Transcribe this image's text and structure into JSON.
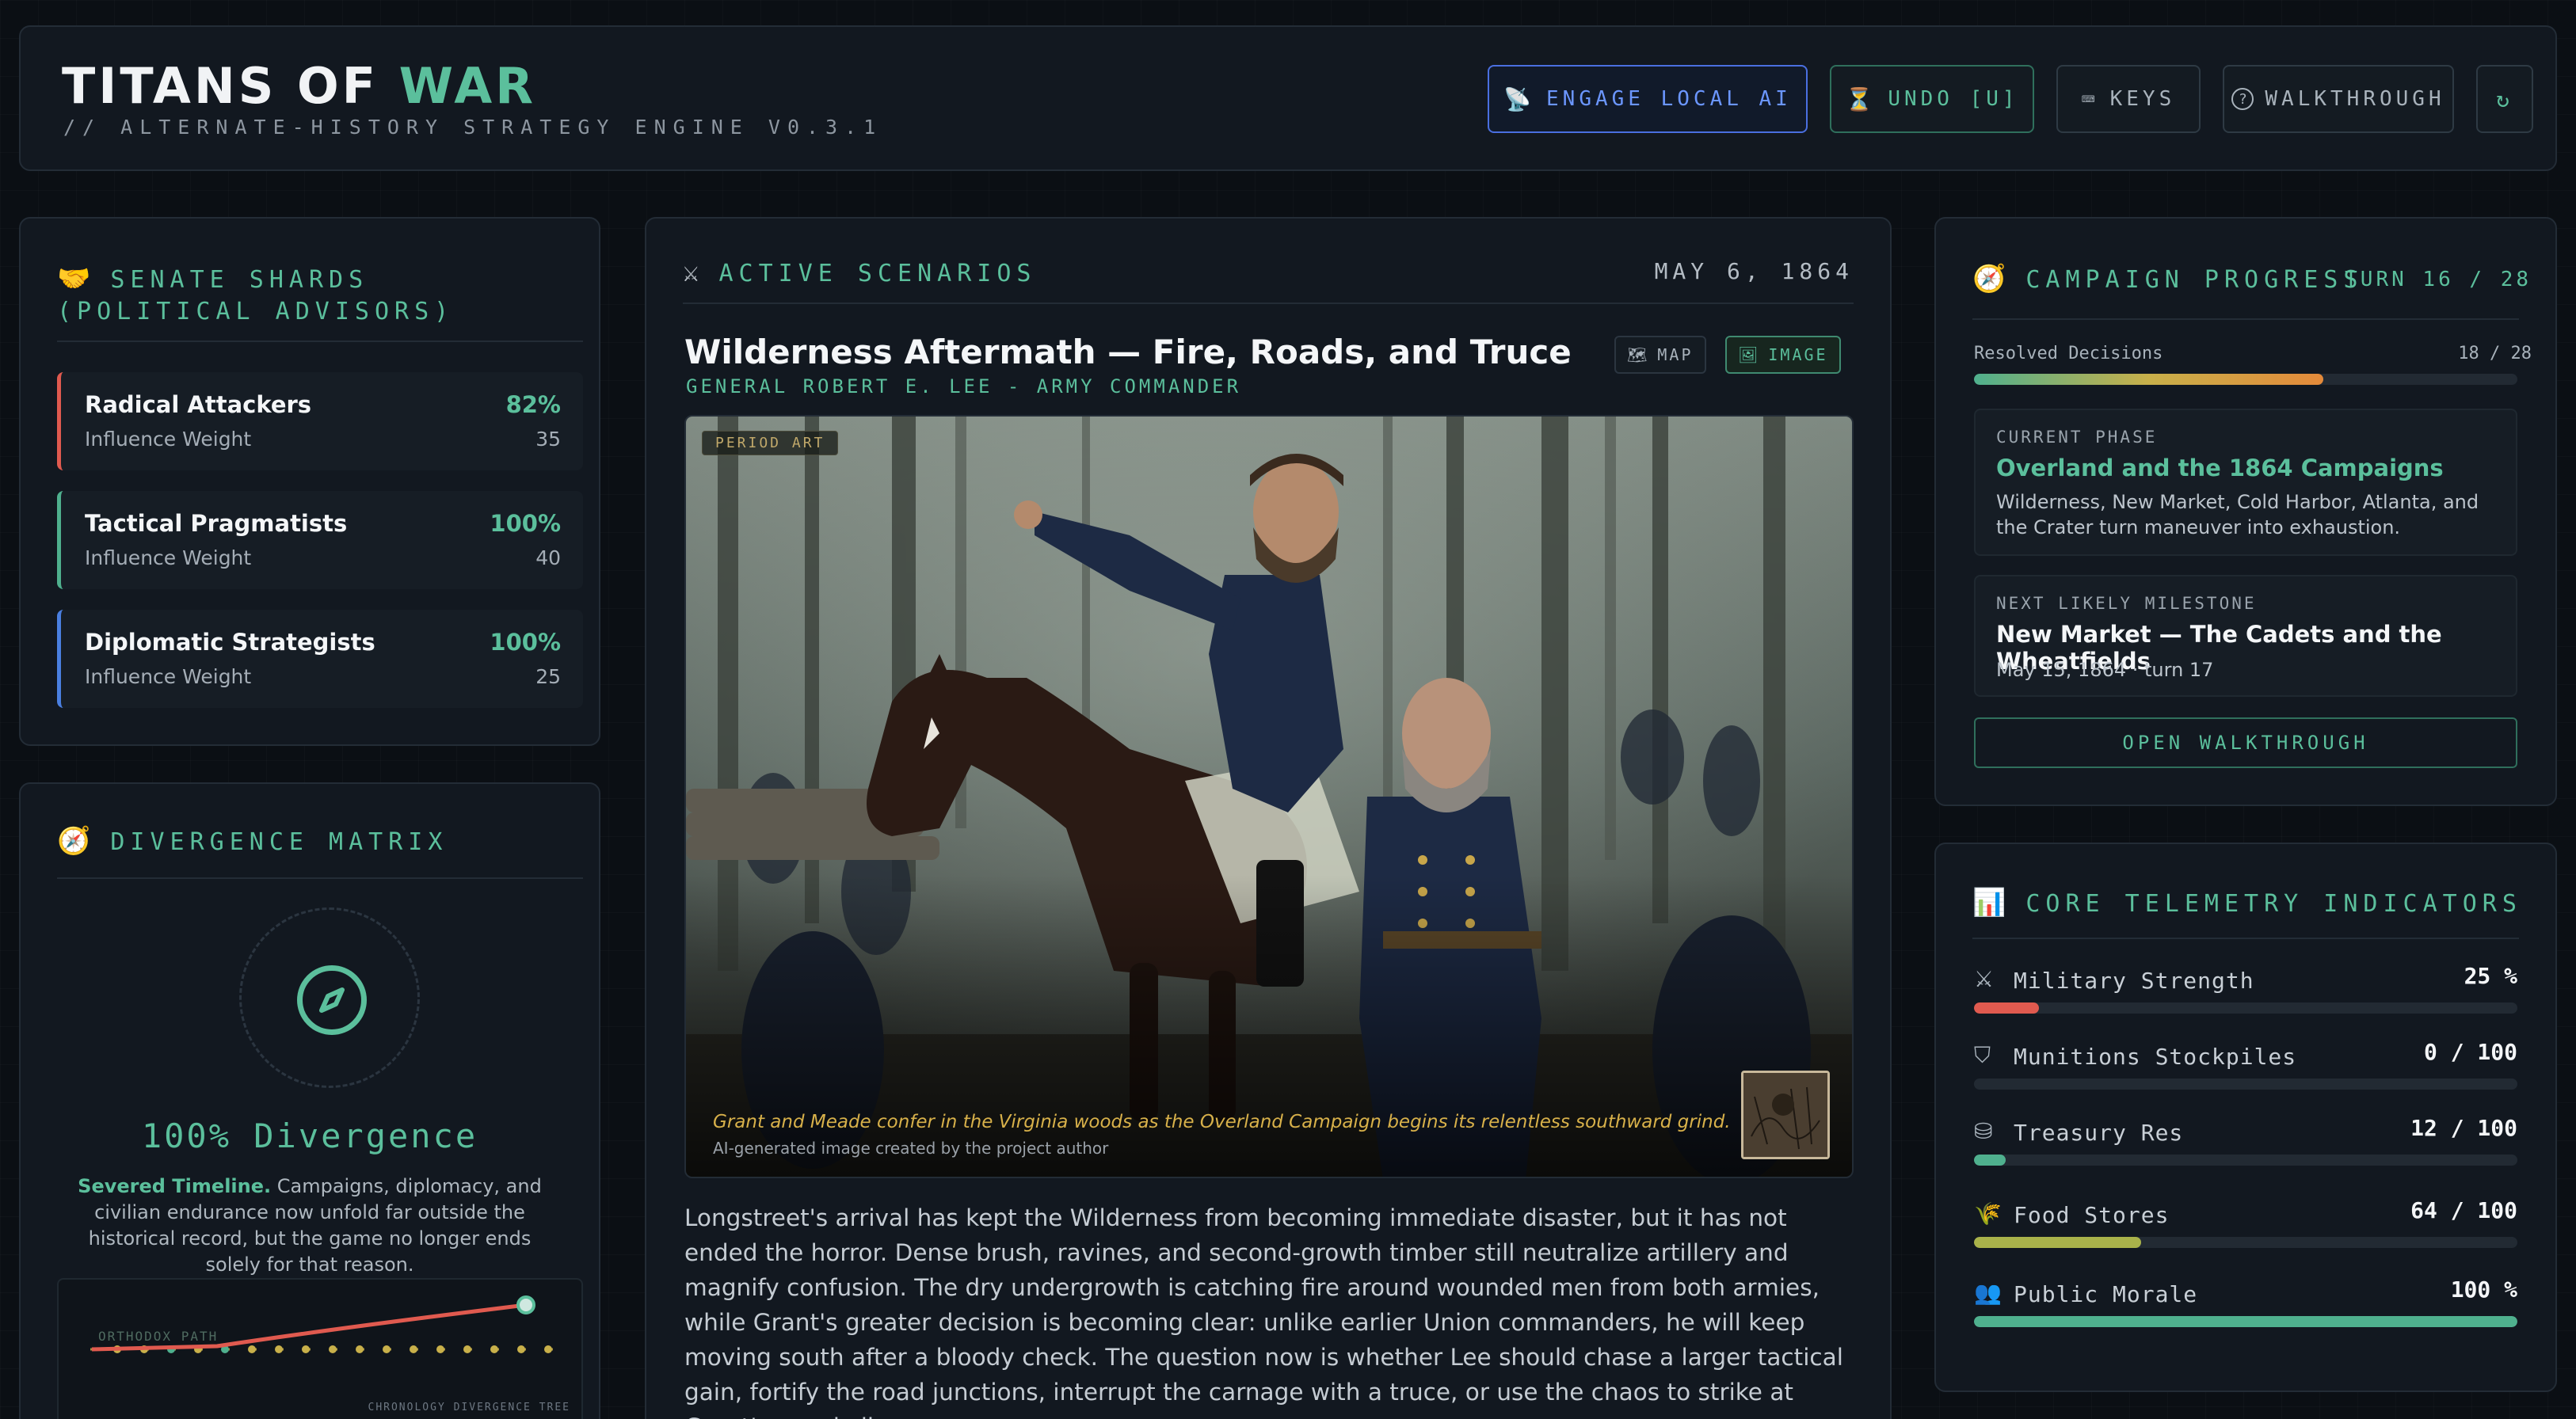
{
  "header": {
    "title_main": "TITANS OF",
    "title_accent": "WAR",
    "subtitle": "// ALTERNATE-HISTORY STRATEGY ENGINE V0.3.1",
    "buttons": {
      "engage_ai": "ENGAGE LOCAL AI",
      "undo": "UNDO [U]",
      "keys": "KEYS",
      "walkthrough": "WALKTHROUGH"
    }
  },
  "senate": {
    "title": "SENATE SHARDS (POLITICAL ADVISORS)",
    "shards": [
      {
        "name": "Radical Attackers",
        "label": "Influence Weight",
        "pct": "82%",
        "weight": "35",
        "color": "#e05a4f"
      },
      {
        "name": "Tactical Pragmatists",
        "label": "Influence Weight",
        "pct": "100%",
        "weight": "40",
        "color": "#4fb08e"
      },
      {
        "name": "Diplomatic Strategists",
        "label": "Influence Weight",
        "pct": "100%",
        "weight": "25",
        "color": "#4a7fe0"
      }
    ]
  },
  "divergence": {
    "title": "DIVERGENCE MATRIX",
    "value": "100% Divergence",
    "lead": "Severed Timeline.",
    "desc": "Campaigns, diplomacy, and civilian endurance now unfold far outside the historical record, but the game no longer ends solely for that reason.",
    "tree_path_label": "ORTHODOX PATH",
    "tree_caption": "CHRONOLOGY DIVERGENCE TREE"
  },
  "scenario": {
    "section": "ACTIVE SCENARIOS",
    "date": "MAY 6, 1864",
    "title": "Wilderness Aftermath — Fire, Roads, and Truce",
    "subtitle": "GENERAL ROBERT E. LEE - ARMY COMMANDER",
    "toggle_map": "MAP",
    "toggle_image": "IMAGE",
    "art_badge": "PERIOD ART",
    "caption": "Grant and Meade confer in the Virginia woods as the Overland Campaign begins its relentless southward grind.",
    "credit": "AI-generated image created by the project author",
    "body": "Longstreet's arrival has kept the Wilderness from becoming immediate disaster, but it has not ended the horror. Dense brush, ravines, and second-growth timber still neutralize artillery and magnify confusion. The dry undergrowth is catching fire around wounded men from both armies, while Grant's greater decision is becoming clear: unlike earlier Union commanders, he will keep moving south after a bloody check. The question now is whether Lee should chase a larger tactical gain, fortify the road junctions, interrupt the carnage with a truce, or use the chaos to strike at Grant's supply line."
  },
  "campaign": {
    "title": "CAMPAIGN PROGRESS",
    "turn": "TURN 16 / 28",
    "resolved_label": "Resolved Decisions",
    "resolved_value": "18 / 28",
    "resolved_fraction": 0.643,
    "phase_key": "CURRENT PHASE",
    "phase_title": "Overland and the 1864 Campaigns",
    "phase_desc": "Wilderness, New Market, Cold Harbor, Atlanta, and the Crater turn maneuver into exhaustion.",
    "milestone_key": "NEXT LIKELY MILESTONE",
    "milestone_title": "New Market — The Cadets and the Wheatfields",
    "milestone_date": "May 15, 1864 · turn 17",
    "open_walkthrough": "OPEN WALKTHROUGH"
  },
  "telemetry": {
    "title": "CORE TELEMETRY INDICATORS",
    "rows": [
      {
        "icon": "swords-icon",
        "label": "Military Strength",
        "value": "25 %",
        "fraction": 0.12,
        "color": "#e05a4f"
      },
      {
        "icon": "shield-icon",
        "label": "Munitions Stockpiles",
        "value": "0 / 100",
        "fraction": 0.0,
        "color": "#4fb08e"
      },
      {
        "icon": "coins-icon",
        "label": "Treasury Res",
        "value": "12 / 100",
        "fraction": 0.058,
        "color": "#4fb08e"
      },
      {
        "icon": "wheat-icon",
        "label": "Food Stores",
        "value": "64 / 100",
        "fraction": 0.308,
        "color": "#a9b24a"
      },
      {
        "icon": "users-icon",
        "label": "Public Morale",
        "value": "100 %",
        "fraction": 1.0,
        "color": "#4fb08e"
      }
    ]
  }
}
